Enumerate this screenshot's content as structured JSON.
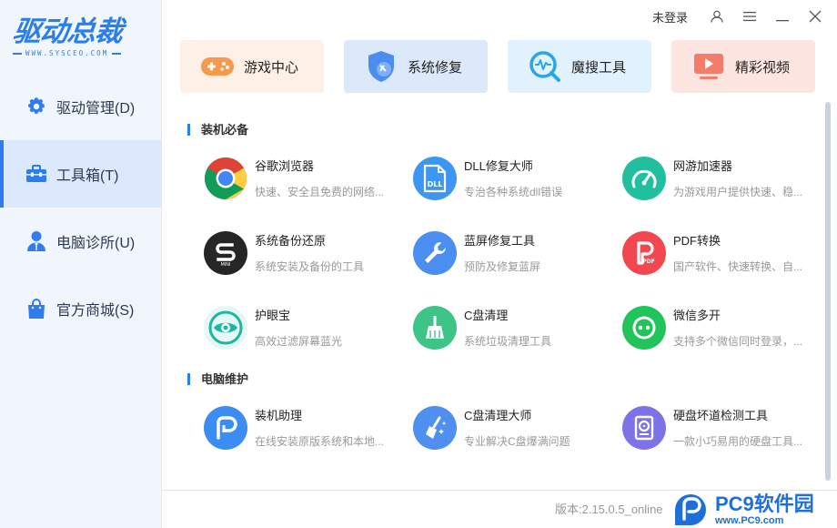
{
  "brand": {
    "logo_text": "驱动总裁",
    "logo_sub": "WWW.SYSCEO.COM"
  },
  "sidebar": {
    "items": [
      {
        "label": "驱动管理(D)",
        "icon": "gear-icon",
        "active": false
      },
      {
        "label": "工具箱(T)",
        "icon": "toolbox-icon",
        "active": true
      },
      {
        "label": "电脑诊所(U)",
        "icon": "doctor-icon",
        "active": false
      },
      {
        "label": "官方商城(S)",
        "icon": "shopping-bag-icon",
        "active": false
      }
    ]
  },
  "topbar": {
    "login_label": "未登录",
    "icons": [
      "user-icon",
      "menu-icon",
      "minimize-icon",
      "close-icon"
    ]
  },
  "tiles": [
    {
      "label": "游戏中心",
      "icon": "gamepad-icon"
    },
    {
      "label": "系统修复",
      "icon": "shield-wrench-icon"
    },
    {
      "label": "魔搜工具",
      "icon": "search-pulse-icon"
    },
    {
      "label": "精彩视频",
      "icon": "video-play-icon"
    }
  ],
  "sections": [
    {
      "title": "装机必备",
      "apps": [
        {
          "name": "谷歌浏览器",
          "desc": "快速、安全且免费的网络...",
          "icon": "chrome-icon"
        },
        {
          "name": "DLL修复大师",
          "desc": "专治各种系统dll错误",
          "icon": "dll-icon"
        },
        {
          "name": "网游加速器",
          "desc": "为游戏用户提供快速、稳...",
          "icon": "speedometer-icon"
        },
        {
          "name": "系统备份还原",
          "desc": "系统安装及备份的工具",
          "icon": "backup-s-icon"
        },
        {
          "name": "蓝屏修复工具",
          "desc": "预防及修复蓝屏",
          "icon": "wrench-icon"
        },
        {
          "name": "PDF转换",
          "desc": "国产软件、快速转换、自...",
          "icon": "pdf-icon"
        },
        {
          "name": "护眼宝",
          "desc": "高效过滤屏幕蓝光",
          "icon": "eye-icon"
        },
        {
          "name": "C盘清理",
          "desc": "系统垃圾清理工具",
          "icon": "broom-icon"
        },
        {
          "name": "微信多开",
          "desc": "支持多个微信同时登录，...",
          "icon": "wechat-multi-icon"
        }
      ]
    },
    {
      "title": "电脑维护",
      "apps": [
        {
          "name": "装机助理",
          "desc": "在线安装原版系统和本地...",
          "icon": "install-p-icon"
        },
        {
          "name": "C盘清理大师",
          "desc": "专业解决C盘爆满问题",
          "icon": "broom-sparkle-icon"
        },
        {
          "name": "硬盘坏道检测工具",
          "desc": "一款小巧易用的硬盘工具...",
          "icon": "harddisk-icon"
        }
      ]
    }
  ],
  "footer": {
    "version": "版本:2.15.0.5_online"
  },
  "watermark": {
    "title": "PC9软件园",
    "url": "www.PC9.com"
  },
  "colors": {
    "accent": "#2f7cf1",
    "sidebar_bg": "#f1f6fd",
    "active_bg": "#dce8fb"
  }
}
